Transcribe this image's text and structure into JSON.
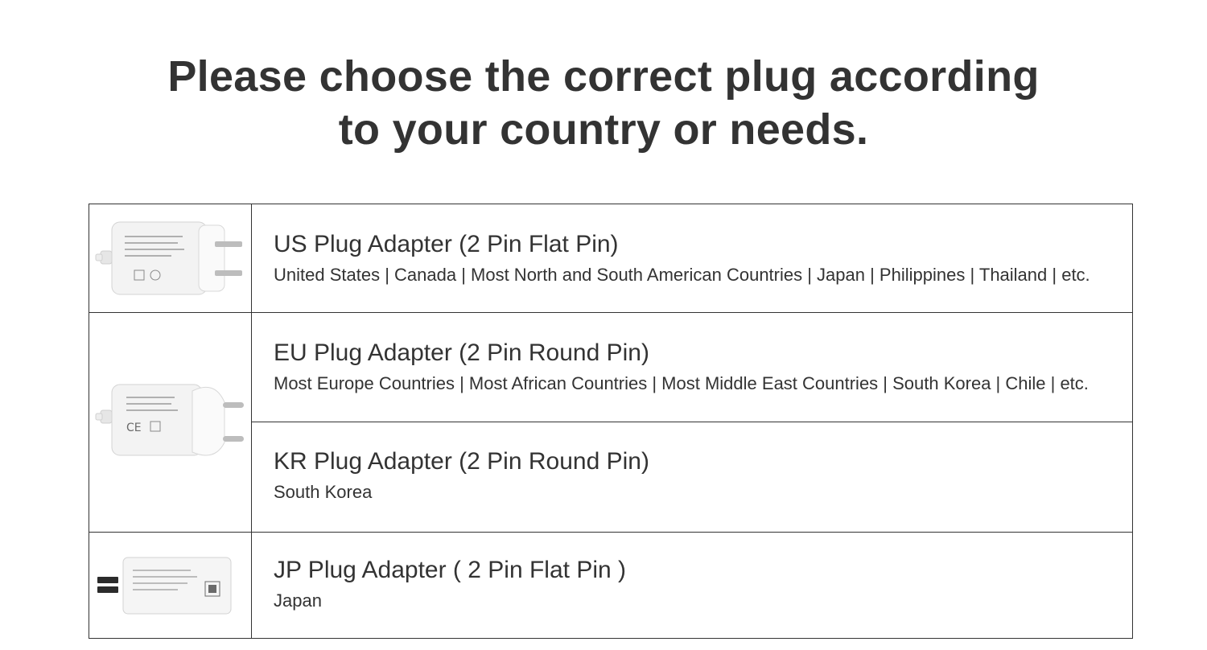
{
  "headline": {
    "line1": "Please choose the correct plug according",
    "line2": "to your country or needs."
  },
  "plugs": [
    {
      "title": "US Plug Adapter (2 Pin Flat Pin)",
      "countries": "United States | Canada | Most North and South American Countries | Japan | Philippines | Thailand | etc."
    },
    {
      "title": "EU Plug Adapter (2 Pin Round Pin)",
      "countries": "Most Europe Countries | Most African Countries | Most Middle East Countries | South Korea | Chile | etc."
    },
    {
      "title": "KR Plug Adapter (2 Pin Round Pin)",
      "countries": "South Korea"
    },
    {
      "title": "JP Plug Adapter ( 2 Pin Flat Pin )",
      "countries": "Japan"
    }
  ],
  "colors": {
    "text": "#333333",
    "border": "#333333",
    "adapter_body": "#f2f2f2",
    "pin": "#b5b5b5"
  },
  "images": [
    "us-plug-adapter-photo",
    "eu-kr-plug-adapter-photo",
    "jp-plug-adapter-photo"
  ]
}
